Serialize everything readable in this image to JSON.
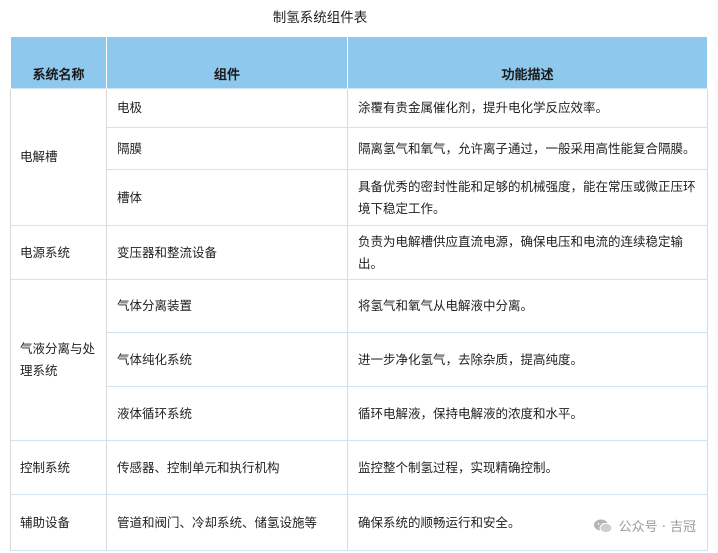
{
  "title": "制氢系统组件表",
  "headers": {
    "system": "系统名称",
    "component": "组件",
    "function": "功能描述"
  },
  "groups": [
    {
      "system": "电解槽",
      "rows": [
        {
          "component": "电极",
          "function": "涂覆有贵金属催化剂，提升电化学反应效率。"
        },
        {
          "component": "隔膜",
          "function": "隔离氢气和氧气，允许离子通过，一般采用高性能复合隔膜。"
        },
        {
          "component": "槽体",
          "function": "具备优秀的密封性能和足够的机械强度，能在常压或微正压环境下稳定工作。"
        }
      ]
    },
    {
      "system": "电源系统",
      "rows": [
        {
          "component": "变压器和整流设备",
          "function": "负责为电解槽供应直流电源，确保电压和电流的连续稳定输出。"
        }
      ]
    },
    {
      "system": "气液分离与处理系统",
      "rows": [
        {
          "component": "气体分离装置",
          "function": "将氢气和氧气从电解液中分离。"
        },
        {
          "component": "气体纯化系统",
          "function": "进一步净化氢气，去除杂质，提高纯度。"
        },
        {
          "component": "液体循环系统",
          "function": "循环电解液，保持电解液的浓度和水平。"
        }
      ]
    },
    {
      "system": "控制系统",
      "rows": [
        {
          "component": "传感器、控制单元和执行机构",
          "function": "监控整个制氢过程，实现精确控制。"
        }
      ]
    },
    {
      "system": "辅助设备",
      "rows": [
        {
          "component": "管道和阀门、冷却系统、储氢设施等",
          "function": "确保系统的顺畅运行和安全。"
        }
      ]
    }
  ],
  "watermark": {
    "text": "公众号 · 吉冠",
    "icon": "wechat-icon"
  }
}
